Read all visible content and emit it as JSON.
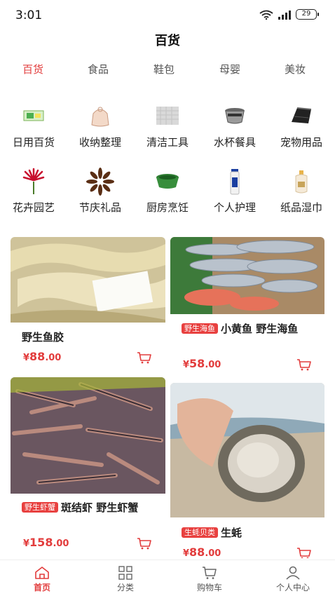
{
  "status_bar": {
    "time": "3:01",
    "battery": "29"
  },
  "header": {
    "title": "百货"
  },
  "tabs": [
    {
      "label": "百货",
      "active": true
    },
    {
      "label": "食品",
      "active": false
    },
    {
      "label": "鞋包",
      "active": false
    },
    {
      "label": "母婴",
      "active": false
    },
    {
      "label": "美妆",
      "active": false
    }
  ],
  "categories": [
    {
      "label": "日用百货",
      "icon": "soap-box-icon"
    },
    {
      "label": "收纳整理",
      "icon": "storage-bag-icon"
    },
    {
      "label": "清洁工具",
      "icon": "cleaning-cloth-icon"
    },
    {
      "label": "水杯餐具",
      "icon": "cookware-icon"
    },
    {
      "label": "宠物用品",
      "icon": "pet-supplies-icon"
    },
    {
      "label": "花卉园艺",
      "icon": "flower-icon"
    },
    {
      "label": "节庆礼品",
      "icon": "star-anise-icon"
    },
    {
      "label": "厨房烹饪",
      "icon": "basin-icon"
    },
    {
      "label": "个人护理",
      "icon": "toothpaste-icon"
    },
    {
      "label": "纸品湿巾",
      "icon": "lotion-bottle-icon"
    }
  ],
  "products": [
    {
      "tag": "",
      "title": "野生鱼胶",
      "price_int": "88",
      "price_dec": ".00",
      "currency": "¥"
    },
    {
      "tag": "野生海鱼",
      "title": "小黄鱼 野生海鱼",
      "price_int": "58",
      "price_dec": ".00",
      "currency": "¥"
    },
    {
      "tag": "野生虾蟹",
      "title": "斑结虾 野生虾蟹",
      "price_int": "158",
      "price_dec": ".00",
      "currency": "¥"
    },
    {
      "tag": "生蚝贝类",
      "title": "生蚝",
      "price_int": "88",
      "price_dec": ".00",
      "currency": "¥"
    }
  ],
  "bottom_nav": [
    {
      "label": "首页",
      "icon": "home-icon",
      "active": true
    },
    {
      "label": "分类",
      "icon": "grid-icon",
      "active": false
    },
    {
      "label": "购物车",
      "icon": "cart-icon",
      "active": false
    },
    {
      "label": "个人中心",
      "icon": "user-icon",
      "active": false
    }
  ],
  "colors": {
    "accent": "#e23c3c",
    "tag_bg": "#e8403f"
  }
}
